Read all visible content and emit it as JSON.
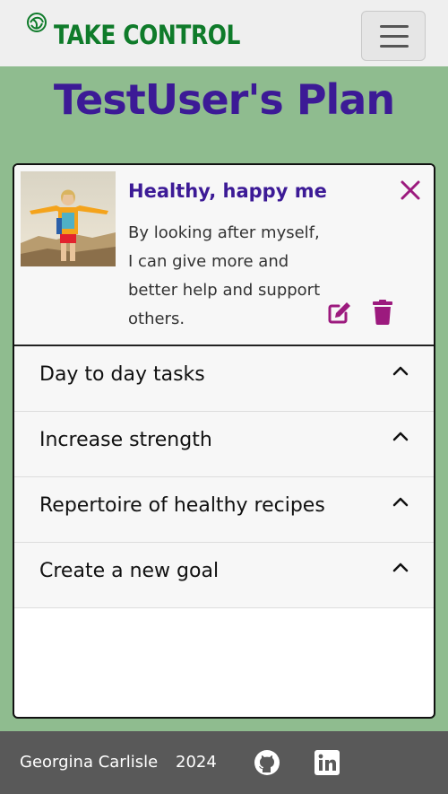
{
  "navbar": {
    "brand": "TAKE CONTROL",
    "brand_icon": "leaf-swirl-icon",
    "menu_icon": "hamburger-menu-icon"
  },
  "page": {
    "title": "TestUser's Plan"
  },
  "vision": {
    "title": "Healthy, happy me",
    "description": "By looking after myself, I can give more and better help and support others.",
    "image": "woman-arms-outstretched-photo",
    "close_icon": "close-icon",
    "edit_icon": "edit-icon",
    "delete_icon": "trash-icon"
  },
  "goals": [
    {
      "label": "Day to day tasks"
    },
    {
      "label": "Increase strength"
    },
    {
      "label": "Repertoire of healthy recipes"
    },
    {
      "label": "Create a new goal"
    }
  ],
  "footer": {
    "name": "Georgina Carlisle",
    "year": "2024",
    "github_icon": "github-icon",
    "linkedin_icon": "linkedin-icon"
  },
  "colors": {
    "background": "#8fbc8f",
    "brand": "#0f7b2a",
    "title": "#3c1a96",
    "accent": "#9c1a7e",
    "footer": "#595959"
  }
}
